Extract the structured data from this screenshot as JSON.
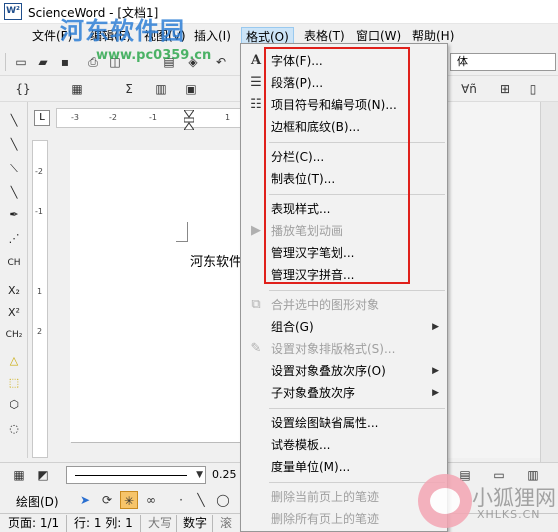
{
  "window": {
    "app_icon_text": "W²",
    "title": "ScienceWord - [文档1]"
  },
  "watermark": {
    "site_name": "河东软件园",
    "url": "www.pc0359.cn",
    "brand_cn": "小狐狸网",
    "brand_en": "XHLKS.CN"
  },
  "menubar": {
    "items": [
      {
        "label": "文件(F)"
      },
      {
        "label": "编辑(E)"
      },
      {
        "label": "视图(V)"
      },
      {
        "label": "插入(I)"
      },
      {
        "label": "格式(O)"
      },
      {
        "label": "表格(T)"
      },
      {
        "label": "窗口(W)"
      },
      {
        "label": "帮助(H)"
      }
    ]
  },
  "toolbar": {
    "font_combo_value": "体",
    "symbols": {
      "sum": "Σ",
      "forall": "∀ñ"
    }
  },
  "document": {
    "text": "河东软件"
  },
  "drawing": {
    "draw_label": "绘图(D)",
    "line_width": "0.25"
  },
  "statusbar": {
    "page": "页面: 1/1",
    "position": "行: 1 列: 1",
    "caps": "大写",
    "num": "数字",
    "scroll": "滚"
  },
  "format_menu": {
    "items": [
      {
        "label": "字体(F)...",
        "enabled": true,
        "icon": "A"
      },
      {
        "label": "段落(P)...",
        "enabled": true,
        "icon": "☰"
      },
      {
        "label": "项目符号和编号项(N)...",
        "enabled": true,
        "icon": "☷"
      },
      {
        "label": "边框和底纹(B)...",
        "enabled": true
      },
      {
        "label": "分栏(C)...",
        "enabled": true
      },
      {
        "label": "制表位(T)...",
        "enabled": true
      },
      {
        "label": "表现样式...",
        "enabled": true
      },
      {
        "label": "播放笔划动画",
        "enabled": false,
        "icon": "▶"
      },
      {
        "label": "管理汉字笔划...",
        "enabled": true
      },
      {
        "label": "管理汉字拼音...",
        "enabled": true
      },
      {
        "label": "合并选中的图形对象",
        "enabled": false,
        "icon": "⧉"
      },
      {
        "label": "组合(G)",
        "enabled": true,
        "submenu": true
      },
      {
        "label": "设置对象排版格式(S)...",
        "enabled": false,
        "icon": "✎"
      },
      {
        "label": "设置对象叠放次序(O)",
        "enabled": true,
        "submenu": true
      },
      {
        "label": "子对象叠放次序",
        "enabled": true,
        "submenu": true
      },
      {
        "label": "设置绘图缺省属性...",
        "enabled": true
      },
      {
        "label": "试卷模板...",
        "enabled": true
      },
      {
        "label": "度量单位(M)...",
        "enabled": true
      },
      {
        "label": "删除当前页上的笔迹",
        "enabled": false
      },
      {
        "label": "删除所有页上的笔迹",
        "enabled": false
      }
    ]
  },
  "ruler": {
    "h_numbers": [
      "-3",
      "-2",
      "-1",
      "1",
      "2"
    ],
    "v_numbers": [
      "-2",
      "-1",
      "1",
      "2"
    ]
  },
  "left_tools": {
    "labels": [
      "CH",
      "X₂",
      "X²",
      "CH₂"
    ]
  },
  "colors": {
    "highlight_box": "#e0201b",
    "menu_hover": "#cce4f7",
    "watermark_blue": "#2e7fd6"
  }
}
